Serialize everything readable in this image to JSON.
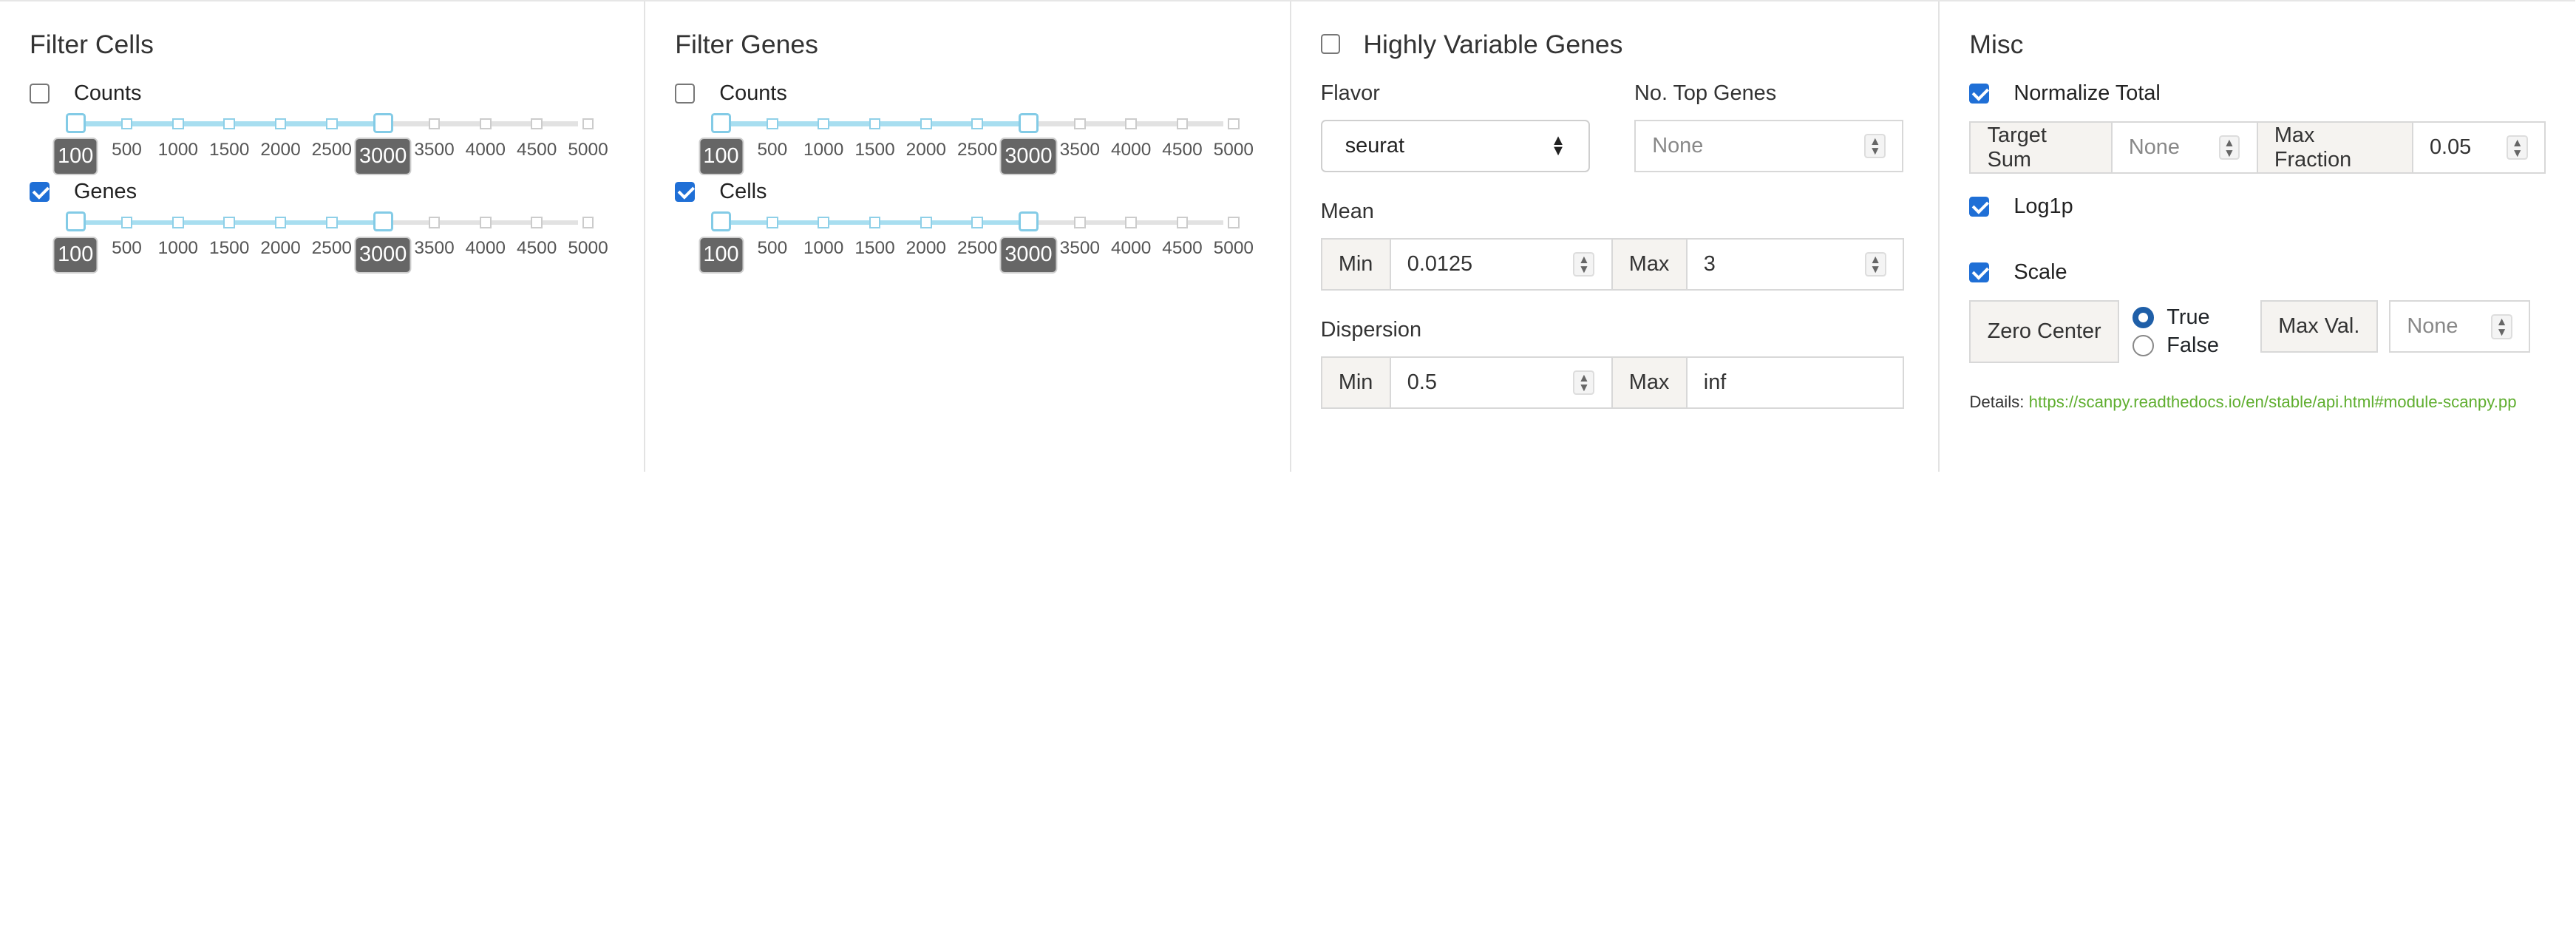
{
  "filter_cells": {
    "title": "Filter Cells",
    "counts": {
      "label": "Counts",
      "checked": false
    },
    "genes": {
      "label": "Genes",
      "checked": true
    }
  },
  "filter_genes": {
    "title": "Filter Genes",
    "counts": {
      "label": "Counts",
      "checked": false
    },
    "cells": {
      "label": "Cells",
      "checked": true
    }
  },
  "slider": {
    "ticks": [
      "100",
      "500",
      "1000",
      "1500",
      "2000",
      "2500",
      "3000",
      "3500",
      "4000",
      "4500",
      "5000"
    ],
    "min_value": 100,
    "max_value": 3000,
    "accent": "#a8def0"
  },
  "hvg": {
    "title": "Highly Variable Genes",
    "checked": false,
    "flavor_label": "Flavor",
    "flavor_value": "seurat",
    "top_genes_label": "No. Top Genes",
    "top_genes_placeholder": "None",
    "mean_label": "Mean",
    "mean_min_label": "Min",
    "mean_min_value": "0.0125",
    "mean_max_label": "Max",
    "mean_max_value": "3",
    "dispersion_label": "Dispersion",
    "disp_min_label": "Min",
    "disp_min_value": "0.5",
    "disp_max_label": "Max",
    "disp_max_value": "inf"
  },
  "misc": {
    "title": "Misc",
    "normalize_label": "Normalize Total",
    "target_sum_label": "Target Sum",
    "target_sum_placeholder": "None",
    "max_fraction_label": "Max Fraction",
    "max_fraction_value": "0.05",
    "log1p_label": "Log1p",
    "scale_label": "Scale",
    "zero_center_label": "Zero Center",
    "true_label": "True",
    "false_label": "False",
    "max_val_label": "Max Val.",
    "max_val_placeholder": "None",
    "details_label": "Details:",
    "details_link": "https://scanpy.readthedocs.io/en/stable/api.html#module-scanpy.pp"
  }
}
